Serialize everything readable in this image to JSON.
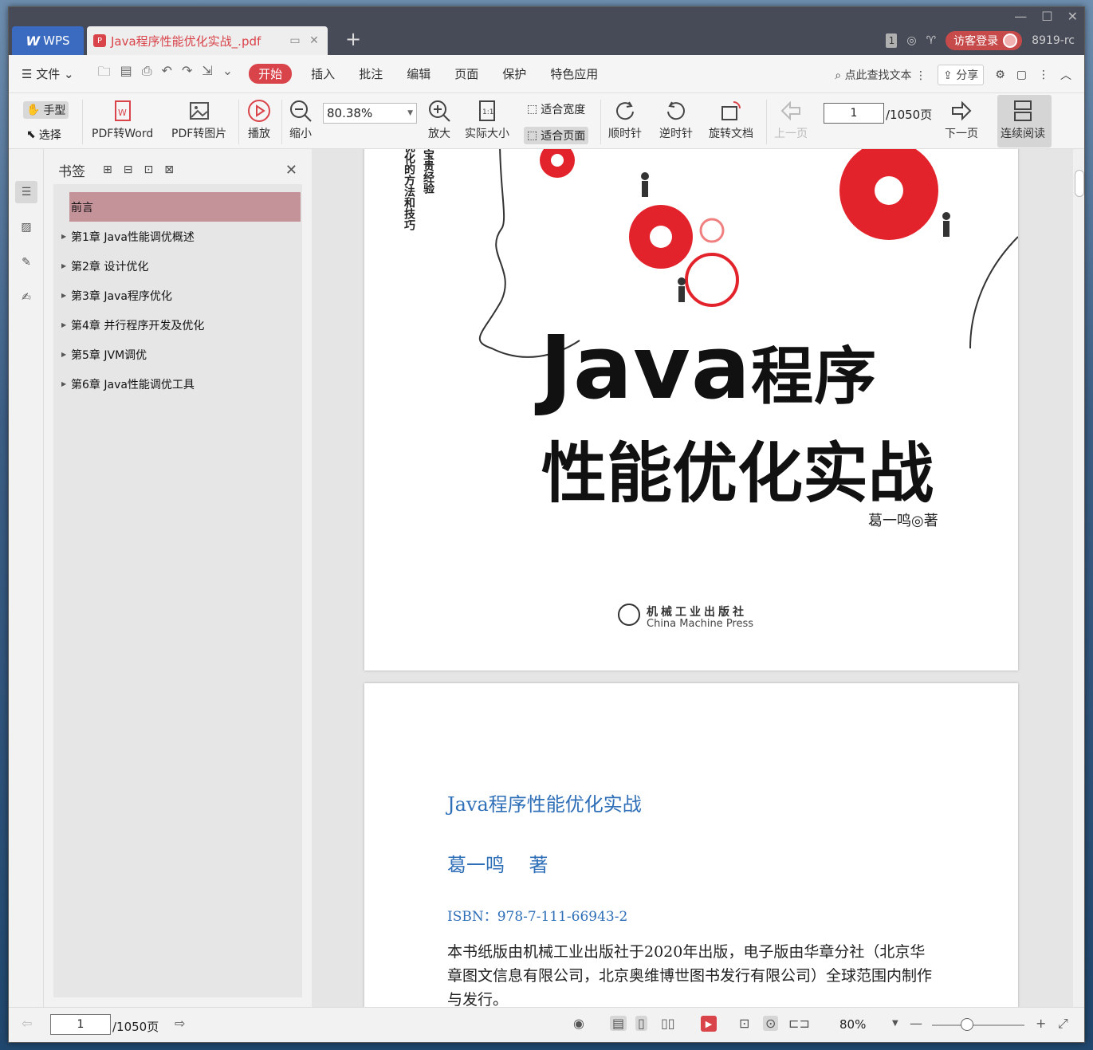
{
  "titlebar": {
    "app_tab": "WPS",
    "doc_tab": "Java程序性能优化实战_.pdf",
    "badge": "1",
    "login": "访客登录",
    "user_id": "8919-rc"
  },
  "menu": {
    "file": "文件",
    "items": [
      "开始",
      "插入",
      "批注",
      "编辑",
      "页面",
      "保护",
      "特色应用"
    ],
    "search": "点此查找文本",
    "share": "分享"
  },
  "toolbar": {
    "hand": "手型",
    "select": "选择",
    "pdf_to_word": "PDF转Word",
    "pdf_to_image": "PDF转图片",
    "play": "播放",
    "zoom_out": "缩小",
    "zoom_value": "80.38%",
    "zoom_in": "放大",
    "actual_size": "实际大小",
    "fit_width": "适合宽度",
    "fit_page": "适合页面",
    "clockwise": "顺时针",
    "counterclockwise": "逆时针",
    "rotate_doc": "旋转文档",
    "prev_page": "上一页",
    "page_number": "1",
    "page_total": "/1050页",
    "next_page": "下一页",
    "continuous": "连续阅读"
  },
  "bookmarks": {
    "title": "书签",
    "items": [
      {
        "label": "前言"
      },
      {
        "label": "第1章 Java性能调优概述"
      },
      {
        "label": "第2章 设计优化"
      },
      {
        "label": "第3章 Java程序优化"
      },
      {
        "label": "第4章 并行程序开发及优化"
      },
      {
        "label": "第5章 JVM调优"
      },
      {
        "label": "第6章 Java性能调优工具"
      }
    ]
  },
  "page1": {
    "vert1": "优化的方法和技巧",
    "vert2": "宝贵经验",
    "title_latin": "Java",
    "title_cn": "程序",
    "subtitle": "性能优化实战",
    "author": "葛一鸣◎著",
    "press_cn": "机械工业出版社",
    "press_en": "China Machine Press"
  },
  "page2": {
    "title": "Java程序性能优化实战",
    "author": "葛一鸣    著",
    "isbn": "ISBN：978-7-111-66943-2",
    "body": "本书纸版由机械工业出版社于2020年出版，电子版由华章分社（北京华章图文信息有限公司，北京奥维博世图书发行有限公司）全球范围内制作与发行。"
  },
  "statusbar": {
    "page_number": "1",
    "page_total": "/1050页",
    "zoom": "80%"
  },
  "colors": {
    "accent": "#d9434a",
    "wps_blue": "#3b6bc1",
    "link_blue": "#2f6fb8",
    "gear_red": "#e3232b"
  }
}
